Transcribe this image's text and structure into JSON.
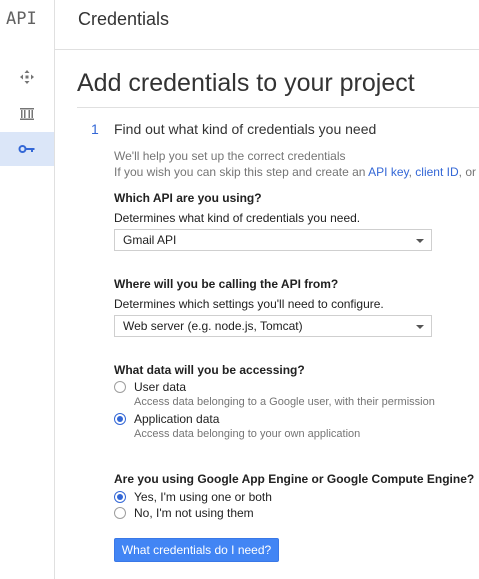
{
  "sidebar": {
    "logo": "API",
    "items": [
      {
        "icon": "move-icon",
        "active": false
      },
      {
        "icon": "library-icon",
        "active": false
      },
      {
        "icon": "key-icon",
        "active": true
      }
    ]
  },
  "header": {
    "title": "Credentials"
  },
  "main": {
    "heading": "Add credentials to your project",
    "step": {
      "number": "1",
      "title": "Find out what kind of credentials you need",
      "help_line1": "We'll help you set up the correct credentials",
      "help_line2_prefix": "If you wish you can skip this step and create an ",
      "link_api_key": "API key",
      "separator": ", ",
      "link_client_id": "client ID",
      "help_line2_suffix": ", or"
    },
    "q_api": {
      "title": "Which API are you using?",
      "desc": "Determines what kind of credentials you need.",
      "selected": "Gmail API"
    },
    "q_calling": {
      "title": "Where will you be calling the API from?",
      "desc": "Determines which settings you'll need to configure.",
      "selected": "Web server (e.g. node.js, Tomcat)"
    },
    "q_data": {
      "title": "What data will you be accessing?",
      "options": [
        {
          "label": "User data",
          "sub": "Access data belonging to a Google user, with their permission",
          "checked": false
        },
        {
          "label": "Application data",
          "sub": "Access data belonging to your own application",
          "checked": true
        }
      ]
    },
    "q_engine": {
      "title": "Are you using Google App Engine or Google Compute Engine?",
      "options": [
        {
          "label": "Yes, I'm using one or both",
          "checked": true
        },
        {
          "label": "No, I'm not using them",
          "checked": false
        }
      ]
    },
    "submit_label": "What credentials do I need?"
  },
  "colors": {
    "accent": "#3367d6",
    "button": "#4285f4",
    "active_nav": "#dbe6f8"
  }
}
